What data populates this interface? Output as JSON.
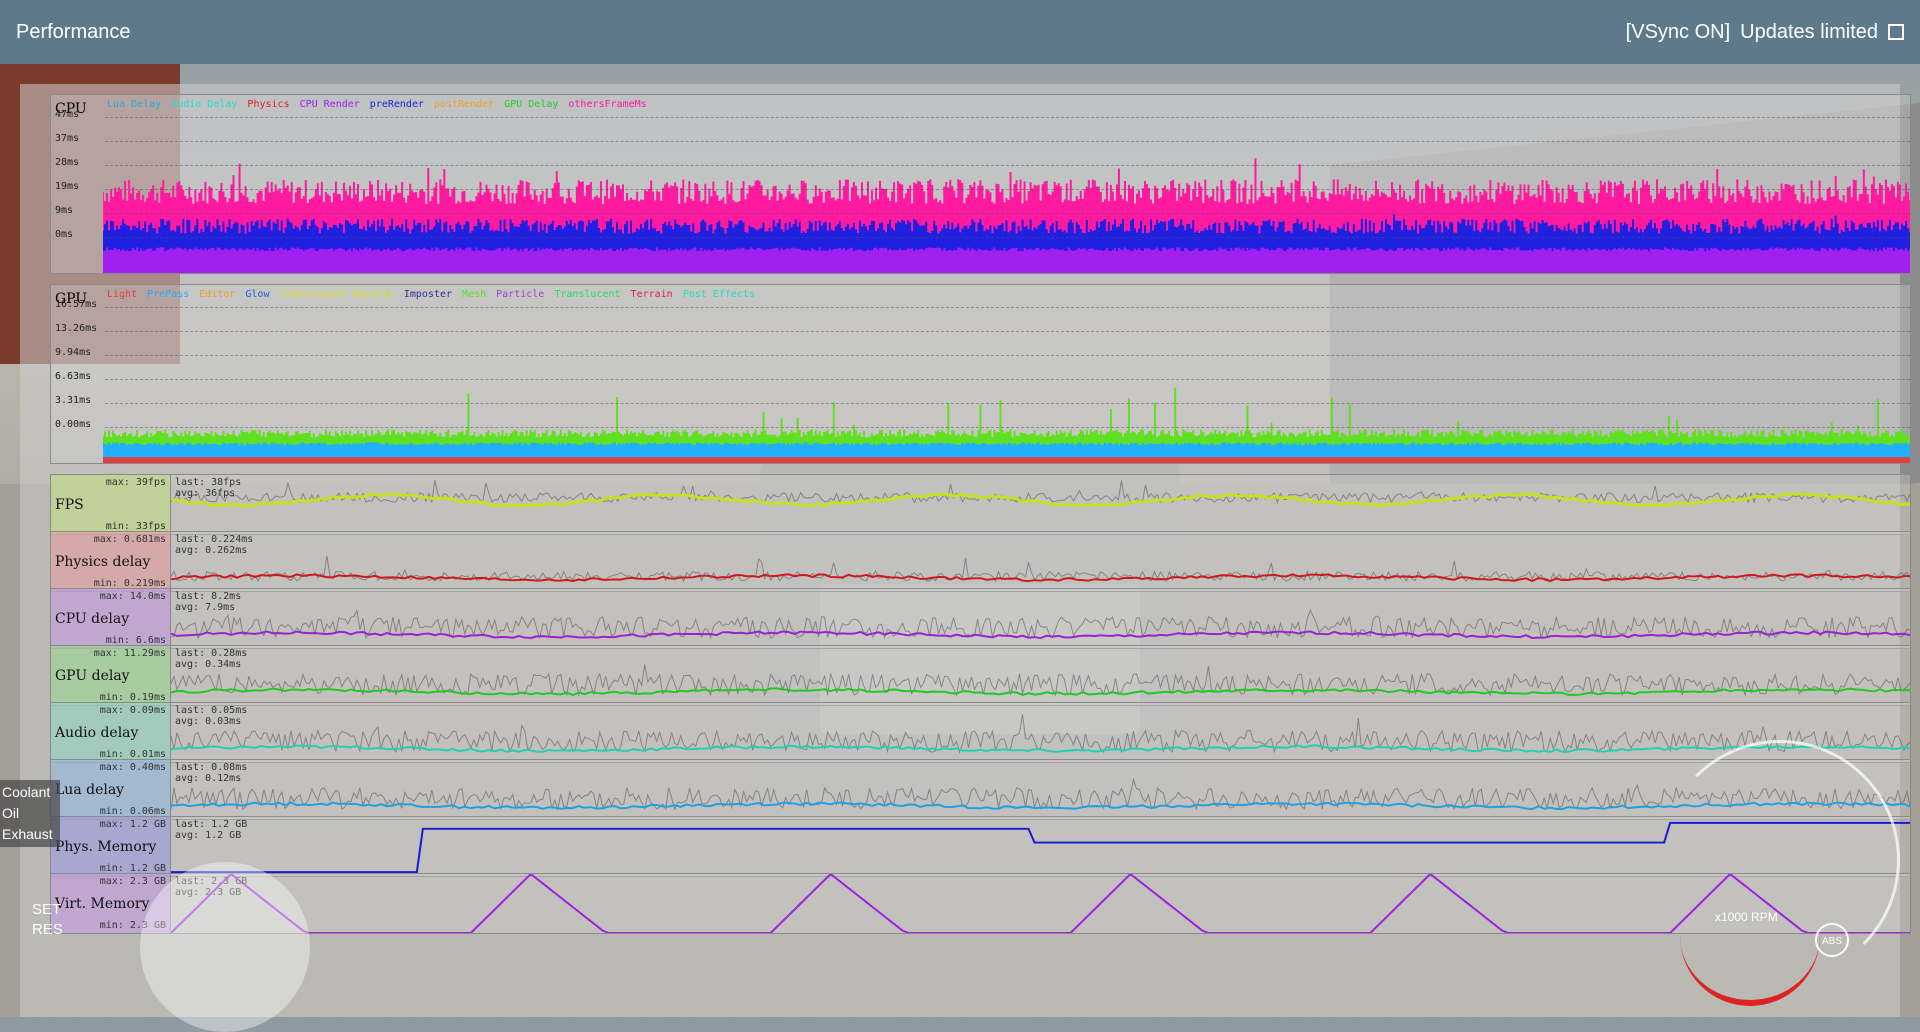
{
  "header": {
    "title": "Performance",
    "vsync": "[VSync ON]",
    "updates_limited": "Updates limited"
  },
  "cpu_graph": {
    "name": "CPU",
    "legend": [
      {
        "label": "Lua Delay",
        "color": "#2aa9e0"
      },
      {
        "label": "Audio Delay",
        "color": "#20e0c0"
      },
      {
        "label": "Physics",
        "color": "#e02020"
      },
      {
        "label": "CPU Render",
        "color": "#a020f0"
      },
      {
        "label": "preRender",
        "color": "#2020e0"
      },
      {
        "label": "postRender",
        "color": "#f0a020"
      },
      {
        "label": "GPU Delay",
        "color": "#20d020"
      },
      {
        "label": "othersFrameMs",
        "color": "#ff1aa0"
      }
    ],
    "y_labels": [
      "47ms",
      "37ms",
      "28ms",
      "19ms",
      "9ms",
      "0ms"
    ]
  },
  "gpu_graph": {
    "name": "GPU",
    "legend": [
      {
        "label": "Light",
        "color": "#e04040"
      },
      {
        "label": "PrePass",
        "color": "#20b0ff"
      },
      {
        "label": "Editor",
        "color": "#f0a020"
      },
      {
        "label": "Glow",
        "color": "#2060d0"
      },
      {
        "label": "Translucent Objects",
        "color": "#e0e020"
      },
      {
        "label": "Imposter",
        "color": "#3030a0"
      },
      {
        "label": "Mesh",
        "color": "#60e020"
      },
      {
        "label": "Particle",
        "color": "#a040d0"
      },
      {
        "label": "Translucent",
        "color": "#20e060"
      },
      {
        "label": "Terrain",
        "color": "#e02060"
      },
      {
        "label": "Post Effects",
        "color": "#20e0c0"
      }
    ],
    "y_labels": [
      "16.57ms",
      "13.26ms",
      "9.94ms",
      "6.63ms",
      "3.31ms",
      "0.00ms"
    ]
  },
  "rows": [
    {
      "label": "FPS",
      "max": "max: 39fps",
      "min": "min: 33fps",
      "last": "last: 38fps",
      "avg": "avg: 36fps",
      "color": "#c8e020",
      "bg": "rgba(190,220,120,0.55)"
    },
    {
      "label": "Physics delay",
      "max": "max: 0.681ms",
      "min": "min: 0.219ms",
      "last": "last: 0.224ms",
      "avg": "avg: 0.262ms",
      "color": "#d01818",
      "bg": "rgba(230,150,150,0.55)"
    },
    {
      "label": "CPU delay",
      "max": "max: 14.0ms",
      "min": "min: 6.6ms",
      "last": "last: 8.2ms",
      "avg": "avg: 7.9ms",
      "color": "#9a20d0",
      "bg": "rgba(190,150,220,0.6)"
    },
    {
      "label": "GPU delay",
      "max": "max: 11.29ms",
      "min": "min: 0.19ms",
      "last": "last: 0.28ms",
      "avg": "avg: 0.34ms",
      "color": "#20c820",
      "bg": "rgba(150,210,140,0.6)"
    },
    {
      "label": "Audio delay",
      "max": "max: 0.09ms",
      "min": "min: 0.01ms",
      "last": "last: 0.05ms",
      "avg": "avg: 0.03ms",
      "color": "#20d0b0",
      "bg": "rgba(140,210,190,0.6)"
    },
    {
      "label": "Lua delay",
      "max": "max: 0.40ms",
      "min": "min: 0.06ms",
      "last": "last: 0.08ms",
      "avg": "avg: 0.12ms",
      "color": "#20a0e0",
      "bg": "rgba(140,180,220,0.6)"
    },
    {
      "label": "Phys. Memory",
      "max": "max: 1.2 GB",
      "min": "min: 1.2 GB",
      "last": "last: 1.2 GB",
      "avg": "avg: 1.2 GB",
      "color": "#1a1ad0",
      "bg": "rgba(150,150,220,0.6)"
    },
    {
      "label": "Virt. Memory",
      "max": "max: 2.3 GB",
      "min": "min: 2.3 GB",
      "last": "last: 2.3 GB",
      "avg": "avg: 2.3 GB",
      "color": "#a020e0",
      "bg": "rgba(190,150,220,0.6)"
    }
  ],
  "hud_left": {
    "items": [
      "Coolant",
      "Oil",
      "Exhaust"
    ],
    "set": "SET",
    "res": "RES"
  },
  "gauge": {
    "rpm_label": "x1000 RPM",
    "abs_label": "ABS"
  }
}
